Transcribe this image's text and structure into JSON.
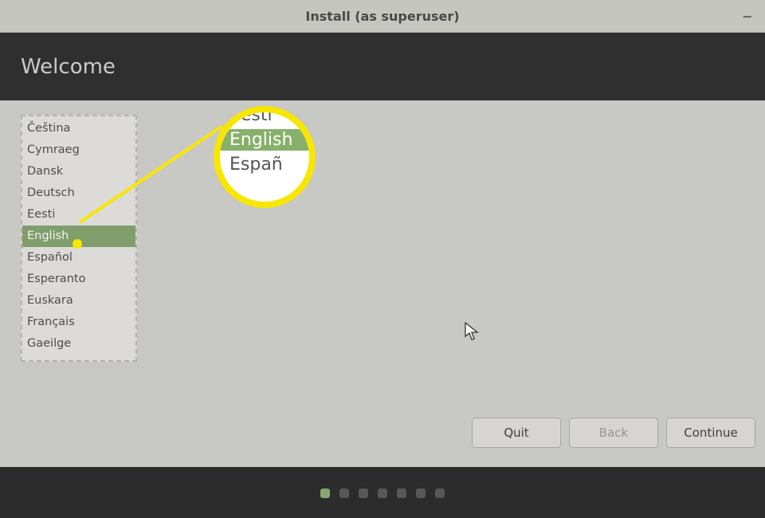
{
  "titlebar": {
    "title": "Install (as superuser)"
  },
  "welcome": {
    "heading": "Welcome"
  },
  "languages": {
    "items": [
      "Čeština",
      "Cymraeg",
      "Dansk",
      "Deutsch",
      "Eesti",
      "English",
      "Español",
      "Esperanto",
      "Euskara",
      "Français",
      "Gaeilge"
    ],
    "selected_index": 5
  },
  "annotation": {
    "rows": [
      "Eesti",
      "English",
      "Españ"
    ],
    "selected_index": 1
  },
  "buttons": {
    "quit": "Quit",
    "back": "Back",
    "continue": "Continue"
  },
  "steps": {
    "count": 7,
    "active_index": 0
  }
}
